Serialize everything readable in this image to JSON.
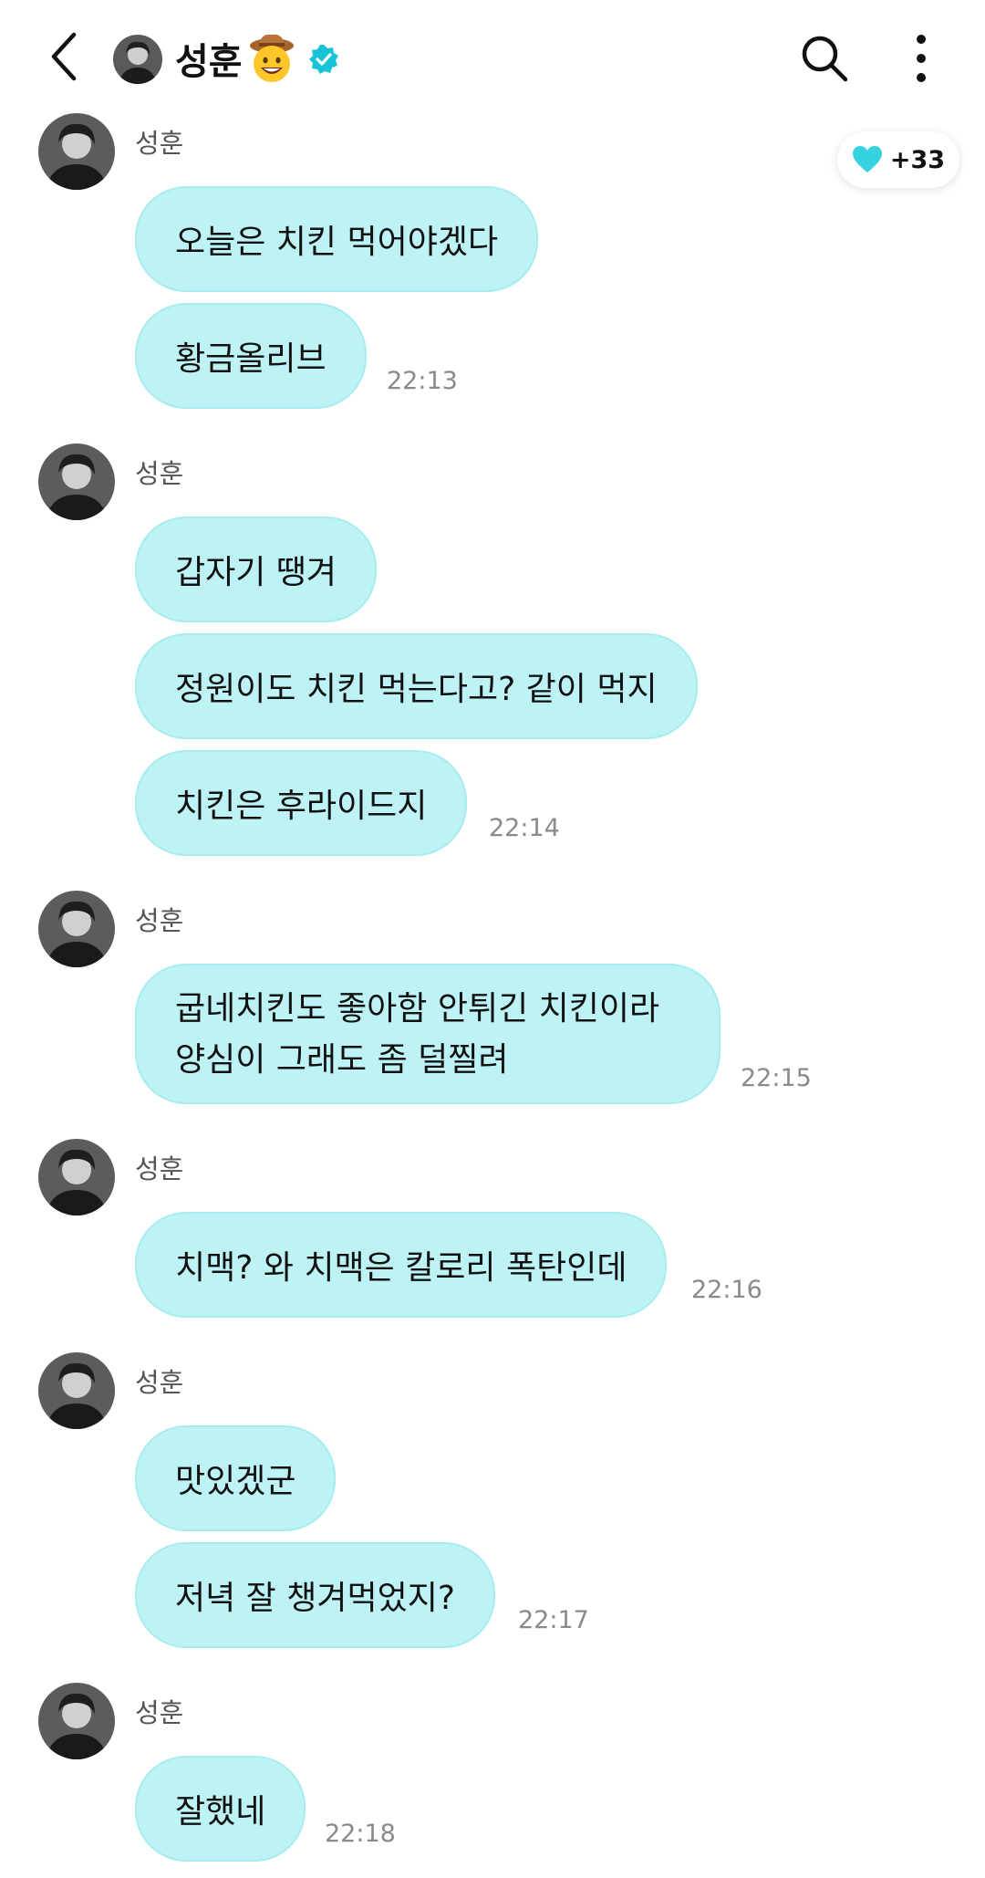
{
  "header": {
    "title": "성훈",
    "emoji": "🤠"
  },
  "reaction": {
    "count": "+33"
  },
  "groups": [
    {
      "sender": "성훈",
      "messages": [
        "오늘은 치킨 먹어야겠다",
        "황금올리브"
      ],
      "time": "22:13"
    },
    {
      "sender": "성훈",
      "messages": [
        "갑자기 땡겨",
        "정원이도 치킨 먹는다고? 같이 먹지",
        "치킨은 후라이드지"
      ],
      "time": "22:14"
    },
    {
      "sender": "성훈",
      "messages": [
        "굽네치킨도 좋아함 안튀긴 치킨이라\n양심이 그래도 좀 덜찔려"
      ],
      "time": "22:15"
    },
    {
      "sender": "성훈",
      "messages": [
        "치맥? 와 치맥은 칼로리 폭탄인데"
      ],
      "time": "22:16"
    },
    {
      "sender": "성훈",
      "messages": [
        "맛있겠군",
        "저녁 잘 챙겨먹었지?"
      ],
      "time": "22:17"
    },
    {
      "sender": "성훈",
      "messages": [
        "잘했네"
      ],
      "time": "22:18"
    }
  ],
  "colors": {
    "bubble": "#bdf3f5",
    "bubble_border": "#a7ecef",
    "verified": "#19c3d6",
    "heart": "#35d3e0"
  }
}
